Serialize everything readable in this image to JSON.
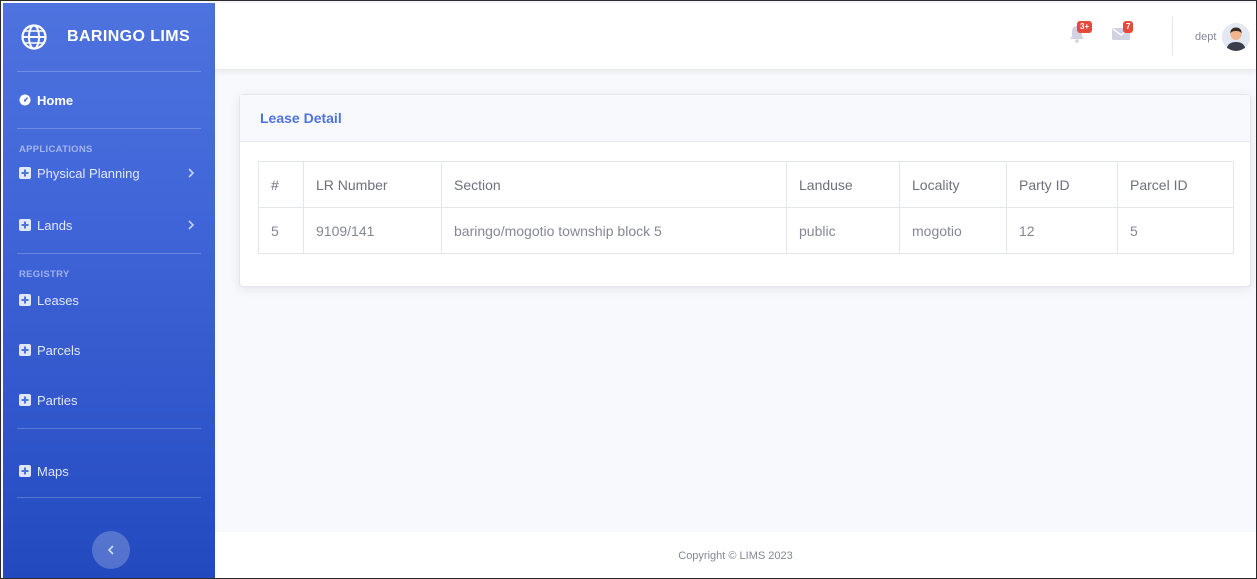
{
  "brand": {
    "name": "BARINGO LIMS",
    "logo_icon": "globe-icon"
  },
  "sidebar": {
    "home": {
      "label": "Home",
      "icon": "tachometer-icon"
    },
    "headings": {
      "applications": "APPLICATIONS",
      "registry": "REGISTRY"
    },
    "items": [
      {
        "label": "Physical Planning",
        "icon": "plus-square-icon",
        "has_children": true
      },
      {
        "label": "Lands",
        "icon": "plus-square-icon",
        "has_children": true
      },
      {
        "label": "Leases",
        "icon": "plus-square-icon"
      },
      {
        "label": "Parcels",
        "icon": "plus-square-icon"
      },
      {
        "label": "Parties",
        "icon": "plus-square-icon"
      },
      {
        "label": "Maps",
        "icon": "plus-square-icon"
      }
    ],
    "toggle_icon": "chevron-left-icon"
  },
  "topbar": {
    "alerts": {
      "icon": "bell-icon",
      "badge": "3+"
    },
    "messages": {
      "icon": "envelope-icon",
      "badge": "7"
    },
    "user": {
      "name": "dept",
      "avatar_icon": "user-avatar"
    }
  },
  "card": {
    "title": "Lease Detail",
    "table": {
      "headers": [
        "#",
        "LR Number",
        "Section",
        "Landuse",
        "Locality",
        "Party ID",
        "Parcel ID"
      ],
      "rows": [
        [
          "5",
          "9109/141",
          "baringo/mogotio township block 5",
          "public",
          "mogotio",
          "12",
          "5"
        ]
      ]
    }
  },
  "footer": {
    "text": "Copyright © LIMS 2023"
  },
  "colors": {
    "primary": "#4e73df",
    "sidebar_gradient_end": "#224abe",
    "badge": "#e74a3b",
    "text_muted": "#858796"
  }
}
